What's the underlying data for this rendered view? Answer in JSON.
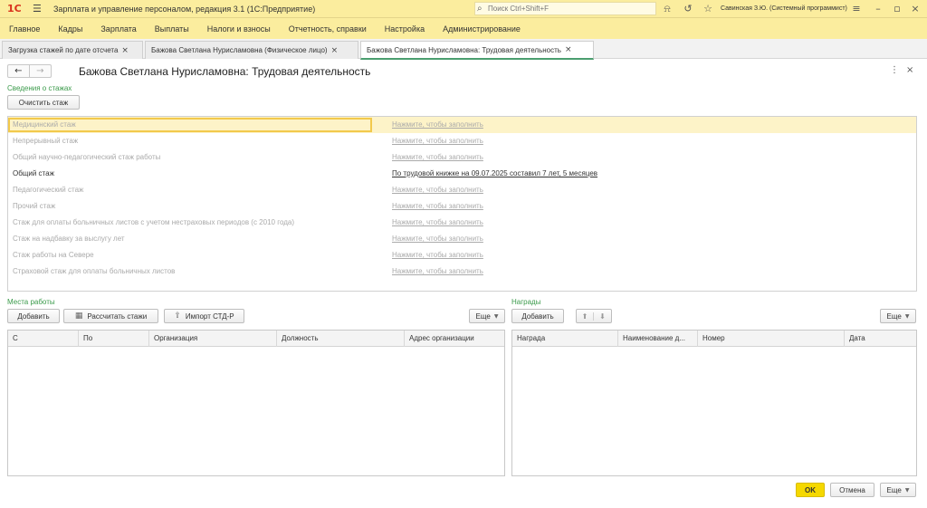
{
  "app": {
    "logo_text": "1С",
    "title": "Зарплата и управление персоналом, редакция 3.1  (1С:Предприятие)",
    "search_placeholder": "Поиск Ctrl+Shift+F",
    "user": "Савинская З.Ю. (Системный программист)"
  },
  "menu": [
    "Главное",
    "Кадры",
    "Зарплата",
    "Выплаты",
    "Налоги и взносы",
    "Отчетность, справки",
    "Настройка",
    "Администрирование"
  ],
  "tabs": [
    {
      "label": "Загрузка стажей по дате отсчета"
    },
    {
      "label": "Бажова Светлана Нурисламовна (Физическое лицо)"
    },
    {
      "label": "Бажова Светлана Нурисламовна: Трудовая деятельность"
    }
  ],
  "form": {
    "title": "Бажова Светлана Нурисламовна: Трудовая деятельность",
    "stazh_section": "Сведения о стажах",
    "clear_button": "Очистить стаж",
    "stazh_rows": [
      {
        "name": "Медицинский стаж",
        "value": "Нажмите, чтобы заполнить",
        "filled": false
      },
      {
        "name": "Непрерывный стаж",
        "value": "Нажмите, чтобы заполнить",
        "filled": false
      },
      {
        "name": "Общий научно-педагогический стаж работы",
        "value": "Нажмите, чтобы заполнить",
        "filled": false
      },
      {
        "name": "Общий стаж",
        "value": "По трудовой книжке на 09.07.2025 составил 7 лет, 5 месяцев",
        "filled": true
      },
      {
        "name": "Педагогический стаж",
        "value": "Нажмите, чтобы заполнить",
        "filled": false
      },
      {
        "name": "Прочий стаж",
        "value": "Нажмите, чтобы заполнить",
        "filled": false
      },
      {
        "name": "Стаж для оплаты больничных листов с учетом нестраховых периодов (с 2010 года)",
        "value": "Нажмите, чтобы заполнить",
        "filled": false
      },
      {
        "name": "Стаж на надбавку за выслугу лет",
        "value": "Нажмите, чтобы заполнить",
        "filled": false
      },
      {
        "name": "Стаж работы на Севере",
        "value": "Нажмите, чтобы заполнить",
        "filled": false
      },
      {
        "name": "Страховой стаж для оплаты больничных листов",
        "value": "Нажмите, чтобы заполнить",
        "filled": false
      }
    ],
    "workplaces": {
      "label": "Места работы",
      "add": "Добавить",
      "calc": "Рассчитать стажи",
      "import": "Импорт СТД-Р",
      "more": "Еще",
      "columns": [
        "С",
        "По",
        "Организация",
        "Должность",
        "Адрес организации"
      ]
    },
    "awards": {
      "label": "Награды",
      "add": "Добавить",
      "more": "Еще",
      "columns": [
        "Награда",
        "Наименование д...",
        "Номер",
        "Дата"
      ]
    },
    "footer": {
      "ok": "OK",
      "cancel": "Отмена",
      "more": "Еще"
    }
  }
}
